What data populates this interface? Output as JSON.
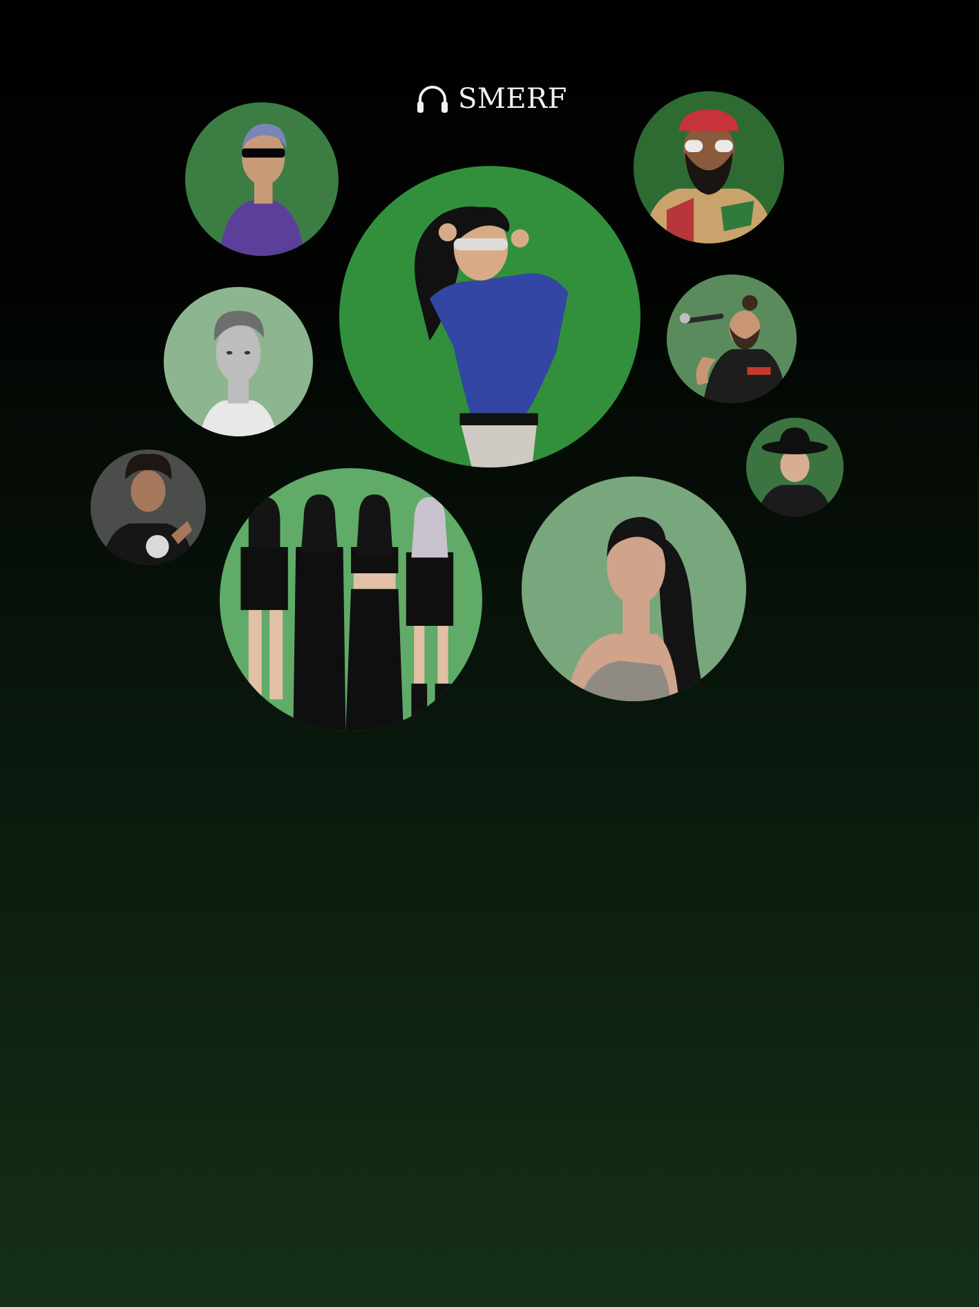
{
  "brand": {
    "name": "SMERF",
    "icon": "headphones-icon",
    "text_color": "#f2f2f2"
  },
  "background": {
    "top_color": "#000000",
    "bottom_color": "#152f18"
  },
  "artists": [
    {
      "id": "rapper-purple-jacket",
      "bg": "#3c7d44",
      "shirt": "#5b3f9a",
      "skin": "#c79a78",
      "hair": "#7a86b8"
    },
    {
      "id": "featured-singer",
      "bg": "#32903d",
      "shirt": "#3346a3",
      "skin": "#d8ab86",
      "hair": "#111111"
    },
    {
      "id": "rapper-red-cap",
      "bg": "#2d6b33",
      "shirt": "#c9a36b",
      "skin": "#8a5a3c",
      "hair": "#1a1512"
    },
    {
      "id": "singer-grayscale",
      "bg": "#8db58f",
      "shirt": "#e8e8e8",
      "skin": "#bdbdbd",
      "hair": "#6e6e6e"
    },
    {
      "id": "performer-microphone",
      "bg": "#5a8b5d",
      "shirt": "#1d1d1d",
      "skin": "#c89673",
      "hair": "#3b2a1d"
    },
    {
      "id": "singer-black-hat",
      "bg": "#3c7441",
      "shirt": "#1b1b1e",
      "skin": "#d7ae91",
      "hair": "#0f0f10"
    },
    {
      "id": "young-artist",
      "bg": "#4b4d4b",
      "shirt": "#161616",
      "skin": "#a6785c",
      "hair": "#1e1612"
    },
    {
      "id": "girl-group",
      "bg": "#60ab68",
      "shirt": "#0f0f0f",
      "skin": "#e1c0a5",
      "hair": "#141414"
    },
    {
      "id": "singer-ponytail",
      "bg": "#79a77d",
      "shirt": "#8f8a82",
      "skin": "#cfa48b",
      "hair": "#141414"
    }
  ]
}
